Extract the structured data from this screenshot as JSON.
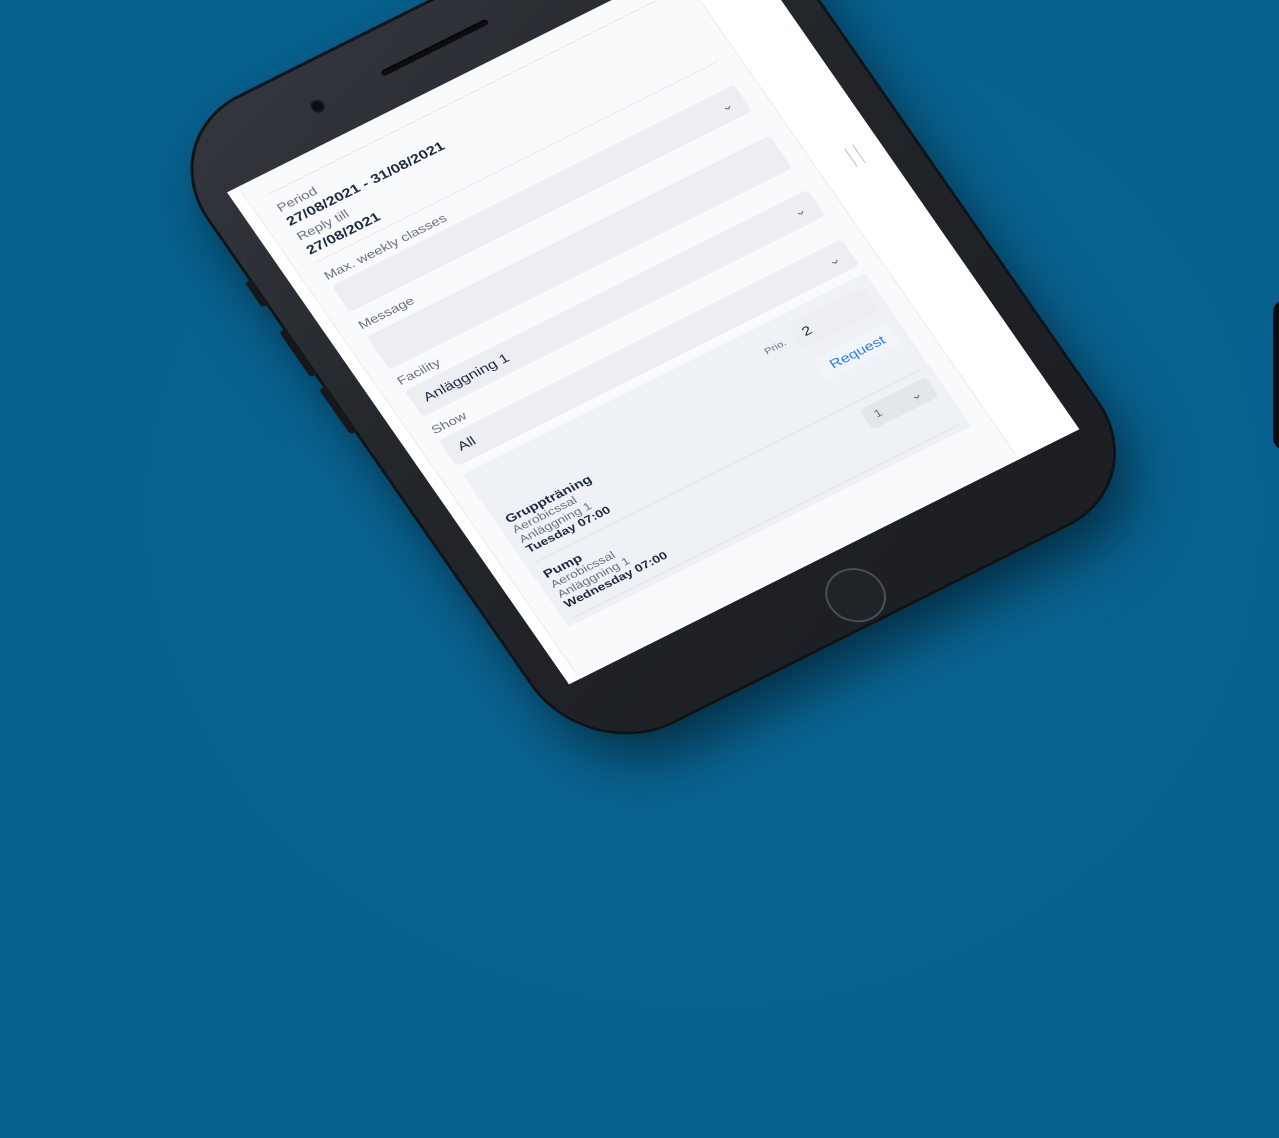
{
  "form": {
    "period_label": "Period",
    "period_value": "27/08/2021 - 31/08/2021",
    "reply_label": "Reply till",
    "reply_value": "27/08/2021",
    "max_classes_label": "Max. weekly classes",
    "message_label": "Message",
    "facility_label": "Facility",
    "facility_value": "Anläggning 1",
    "show_label": "Show",
    "show_value": "All"
  },
  "priority": {
    "label": "Prio.",
    "value": "2"
  },
  "request_label": "Request",
  "classes": [
    {
      "title": "Gruppträning",
      "room": "Aerobicssal",
      "facility": "Anläggning 1",
      "time": "Tuesday 07:00"
    },
    {
      "title": "Pump",
      "room": "Aerobicssal",
      "facility": "Anläggning 1",
      "time": "Wednesday 07:00",
      "select_value": "1"
    }
  ],
  "colors": {
    "background": "#07618f",
    "phone": "#23262b",
    "accent_link": "#2f7ff0",
    "text_dark": "#1f2a44",
    "text_muted": "#6b7380"
  }
}
